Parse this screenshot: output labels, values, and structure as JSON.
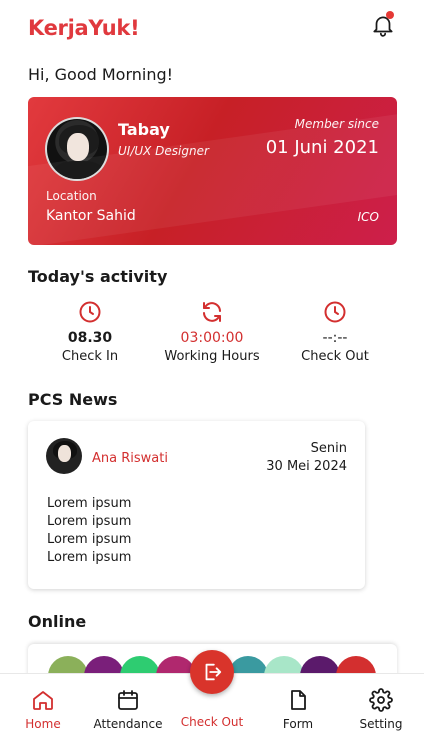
{
  "app": {
    "brand": "KerjaYuk!",
    "accent": "#e0393e"
  },
  "header": {
    "notification_icon": "bell-icon",
    "has_unread": true
  },
  "greeting": "Hi, Good Morning!",
  "profile": {
    "name": "Tabay",
    "role": "UI/UX Designer",
    "member_since_label": "Member since",
    "member_since_date": "01 Juni 2021",
    "location_label": "Location",
    "location_value": "Kantor Sahid",
    "tag": "ICO"
  },
  "activity": {
    "title": "Today's activity",
    "items": [
      {
        "icon": "clock-icon",
        "value": "08.30",
        "label": "Check In"
      },
      {
        "icon": "refresh-icon",
        "value": "03:00:00",
        "label": "Working Hours"
      },
      {
        "icon": "clock-icon",
        "value": "--:--",
        "label": "Check Out"
      }
    ]
  },
  "news": {
    "title": "PCS News",
    "card": {
      "author": "Ana Riswati",
      "day": "Senin",
      "date": "30 Mei 2024",
      "lines": [
        "Lorem ipsum",
        "Lorem ipsum",
        "Lorem ipsum",
        "Lorem ipsum"
      ]
    }
  },
  "online": {
    "title": "Online",
    "avatar_colors": [
      "#8bb05a",
      "#7a1f7a",
      "#2ecc71",
      "#b0286e",
      "#c0392b",
      "#3a9aa0",
      "#a8e6c8",
      "#5b1a6b",
      "#d32f2f"
    ]
  },
  "bottom_nav": {
    "items": [
      {
        "icon": "home-icon",
        "label": "Home",
        "active": true
      },
      {
        "icon": "calendar-icon",
        "label": "Attendance",
        "active": false
      },
      {
        "icon": "logout-icon",
        "label": "Check Out",
        "active": false
      },
      {
        "icon": "document-icon",
        "label": "Form",
        "active": false
      },
      {
        "icon": "gear-icon",
        "label": "Setting",
        "active": false
      }
    ]
  }
}
